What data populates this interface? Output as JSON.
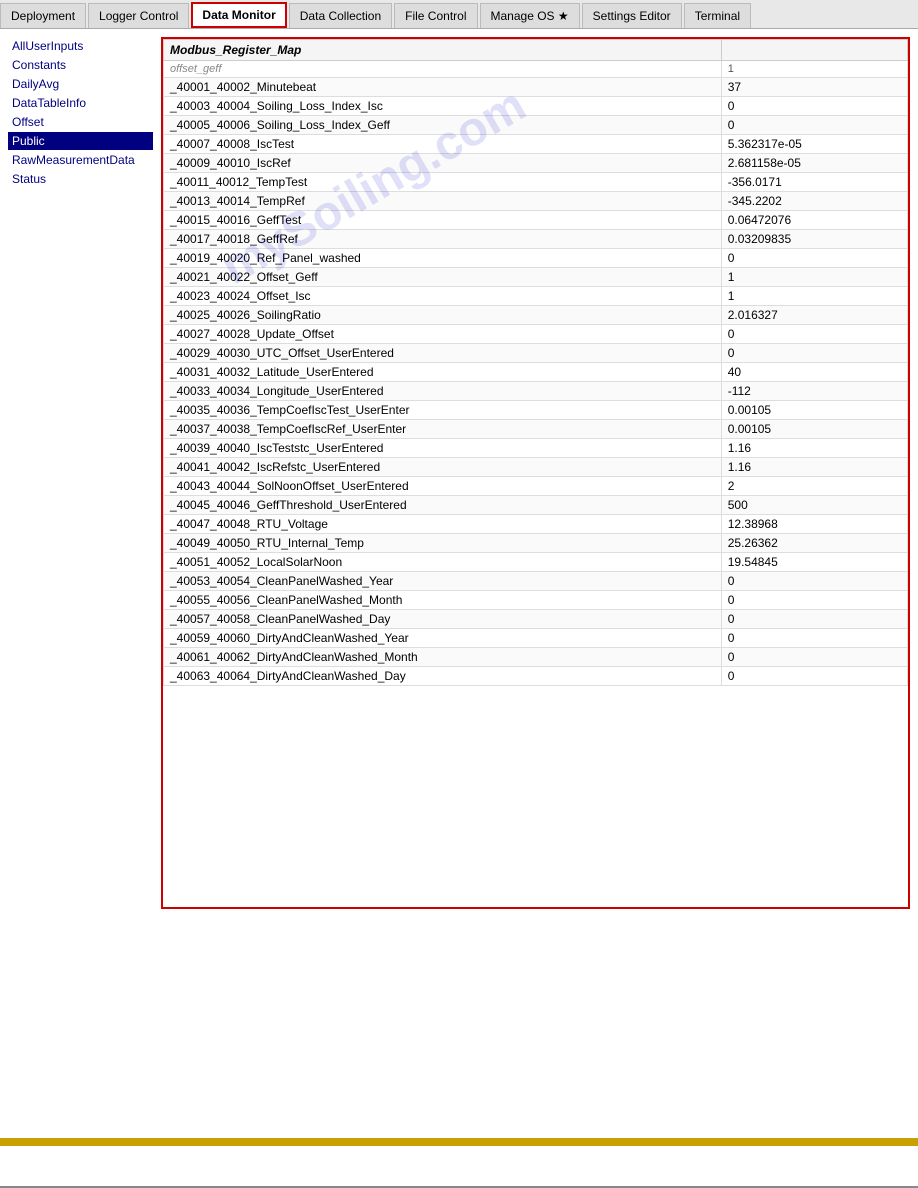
{
  "nav": {
    "tabs": [
      {
        "label": "Deployment",
        "active": false
      },
      {
        "label": "Logger Control",
        "active": false
      },
      {
        "label": "Data Monitor",
        "active": true
      },
      {
        "label": "Data Collection",
        "active": false
      },
      {
        "label": "File Control",
        "active": false
      },
      {
        "label": "Manage OS ★",
        "active": false
      },
      {
        "label": "Settings Editor",
        "active": false
      },
      {
        "label": "Terminal",
        "active": false
      }
    ]
  },
  "sidebar": {
    "items": [
      {
        "label": "AllUserInputs",
        "active": false
      },
      {
        "label": "Constants",
        "active": false
      },
      {
        "label": "DailyAvg",
        "active": false
      },
      {
        "label": "DataTableInfo",
        "active": false
      },
      {
        "label": "Offset",
        "active": false
      },
      {
        "label": "Public",
        "active": true
      },
      {
        "label": "RawMeasurementData",
        "active": false
      },
      {
        "label": "Status",
        "active": false
      }
    ]
  },
  "table": {
    "columns": [
      "Modbus_Register_Map",
      ""
    ],
    "partial_row": {
      "name": "offset_geff",
      "value": "1"
    },
    "rows": [
      {
        "name": "_40001_40002_Minutebeat",
        "value": "37"
      },
      {
        "name": "_40003_40004_Soiling_Loss_Index_Isc",
        "value": "0"
      },
      {
        "name": "_40005_40006_Soiling_Loss_Index_Geff",
        "value": "0"
      },
      {
        "name": "_40007_40008_IscTest",
        "value": "5.362317e-05"
      },
      {
        "name": "_40009_40010_IscRef",
        "value": "2.681158e-05"
      },
      {
        "name": "_40011_40012_TempTest",
        "value": "-356.0171"
      },
      {
        "name": "_40013_40014_TempRef",
        "value": "-345.2202"
      },
      {
        "name": "_40015_40016_GeffTest",
        "value": "0.06472076"
      },
      {
        "name": "_40017_40018_GeffRef",
        "value": "0.03209835"
      },
      {
        "name": "_40019_40020_Ref_Panel_washed",
        "value": "0"
      },
      {
        "name": "_40021_40022_Offset_Geff",
        "value": "1"
      },
      {
        "name": "_40023_40024_Offset_Isc",
        "value": "1"
      },
      {
        "name": "_40025_40026_SoilingRatio",
        "value": "2.016327"
      },
      {
        "name": "_40027_40028_Update_Offset",
        "value": "0"
      },
      {
        "name": "_40029_40030_UTC_Offset_UserEntered",
        "value": "0"
      },
      {
        "name": "_40031_40032_Latitude_UserEntered",
        "value": "40"
      },
      {
        "name": "_40033_40034_Longitude_UserEntered",
        "value": "-112"
      },
      {
        "name": "_40035_40036_TempCoefIscTest_UserEnter",
        "value": "0.00105"
      },
      {
        "name": "_40037_40038_TempCoefIscRef_UserEnter",
        "value": "0.00105"
      },
      {
        "name": "_40039_40040_IscTeststc_UserEntered",
        "value": "1.16"
      },
      {
        "name": "_40041_40042_IscRefstc_UserEntered",
        "value": "1.16"
      },
      {
        "name": "_40043_40044_SolNoonOffset_UserEntered",
        "value": "2"
      },
      {
        "name": "_40045_40046_GeffThreshold_UserEntered",
        "value": "500"
      },
      {
        "name": "_40047_40048_RTU_Voltage",
        "value": "12.38968"
      },
      {
        "name": "_40049_40050_RTU_Internal_Temp",
        "value": "25.26362"
      },
      {
        "name": "_40051_40052_LocalSolarNoon",
        "value": "19.54845"
      },
      {
        "name": "_40053_40054_CleanPanelWashed_Year",
        "value": "0"
      },
      {
        "name": "_40055_40056_CleanPanelWashed_Month",
        "value": "0"
      },
      {
        "name": "_40057_40058_CleanPanelWashed_Day",
        "value": "0"
      },
      {
        "name": "_40059_40060_DirtyAndCleanWashed_Year",
        "value": "0"
      },
      {
        "name": "_40061_40062_DirtyAndCleanWashed_Month",
        "value": "0"
      },
      {
        "name": "_40063_40064_DirtyAndCleanWashed_Day",
        "value": "0"
      }
    ]
  },
  "watermark": "mySoiling.com"
}
